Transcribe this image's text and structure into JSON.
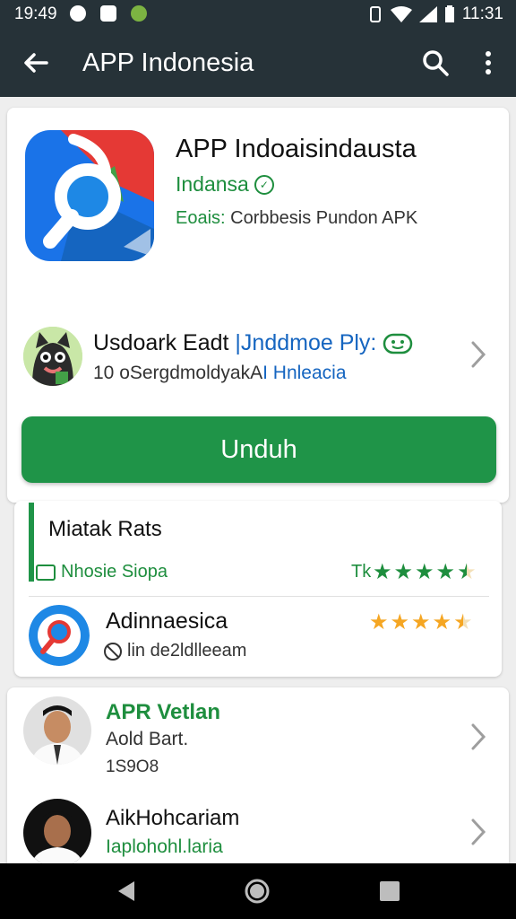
{
  "status_bar": {
    "time_left": "19:49",
    "time_right": "11:31"
  },
  "app_bar": {
    "title": "APP Indonesia"
  },
  "app": {
    "name": "APP Indoaisindausta",
    "developer": "Indansa",
    "description_label": "Eoais:",
    "description_text": " Corbbesis Pundon APK"
  },
  "publisher": {
    "name": "Usdoark Eadt ",
    "name_link": "|Jnddmoe Ply:",
    "subtitle": "10 oSergdmoldyakA",
    "subtitle_link": "I Hnleacia"
  },
  "download_button": {
    "label": "Unduh"
  },
  "ratings": {
    "title": "Miatak Rats",
    "subtitle": "Nhosie Siopa",
    "tk_label": "Tk",
    "rating_value": 4.5,
    "review": {
      "name": "Adinnaesica",
      "subtitle": "lin de2ldlleeam",
      "rating_value": 4.5
    }
  },
  "people": [
    {
      "name": "APR Vetlan",
      "role": "Aold Bart.",
      "meta": "1S9O8",
      "accent": "#1e8e3e"
    },
    {
      "name": "AikHohcariam",
      "role": "Iaplohohl.laria",
      "accent": "#1e8e3e"
    }
  ],
  "colors": {
    "primary_green": "#1f9448",
    "app_bar": "#263238",
    "link_blue": "#1565c0",
    "star": "#f5a623"
  }
}
